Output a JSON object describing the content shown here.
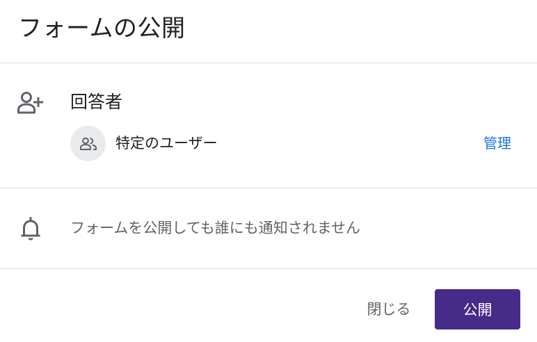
{
  "dialog": {
    "title": "フォームの公開"
  },
  "respondents": {
    "heading": "回答者",
    "icon": "person-add-icon",
    "audience_icon": "group-icon",
    "audience_label": "特定のユーザー",
    "manage_label": "管理"
  },
  "notification": {
    "icon": "bell-icon",
    "text": "フォームを公開しても誰にも通知されません"
  },
  "actions": {
    "close_label": "閉じる",
    "publish_label": "公開"
  },
  "colors": {
    "primary": "#472b88",
    "link": "#1a73e8",
    "text": "#202124",
    "secondary_text": "#5f6368",
    "divider": "#dadce0",
    "avatar_bg": "#e8eaed"
  }
}
